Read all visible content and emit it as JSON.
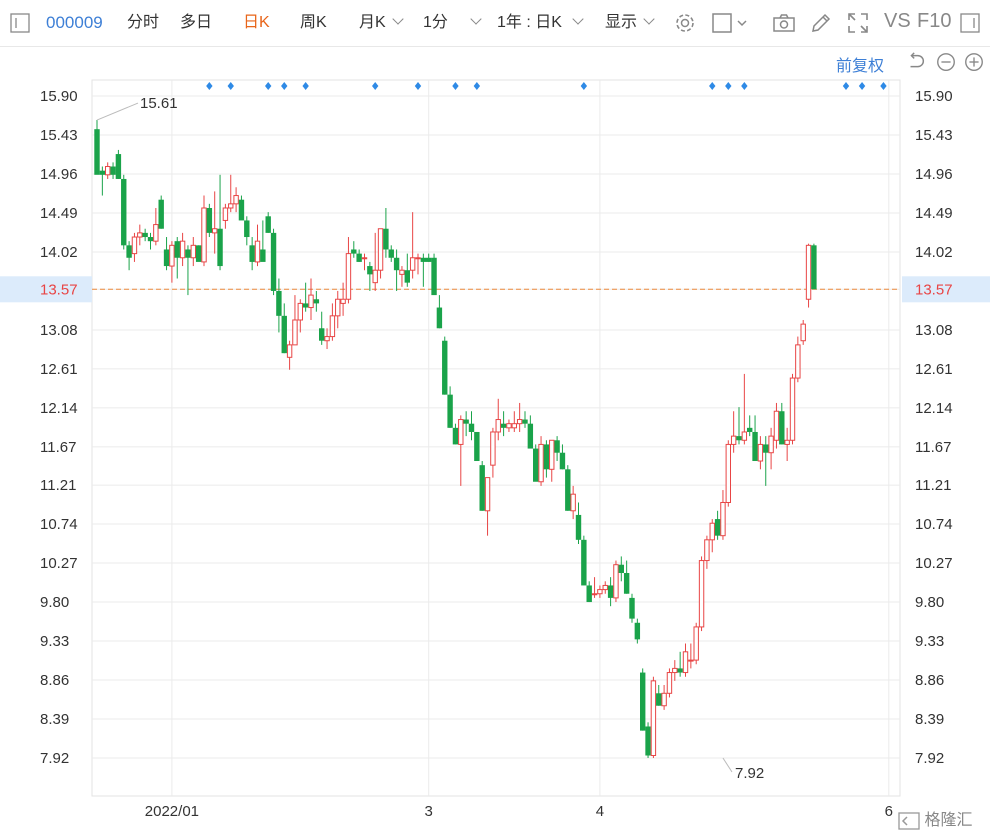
{
  "toolbar": {
    "stock_code": "000009",
    "tabs": [
      "分时",
      "多日",
      "日K",
      "周K",
      "月K",
      "1分"
    ],
    "active_tab": "日K",
    "range_label": "1年 : 日K",
    "display_label": "显示",
    "vs_label": "VS",
    "f10_label": "F10"
  },
  "adjust_label": "前复权",
  "watermark": "格隆汇",
  "colors": {
    "up": "#e84545",
    "down": "#1aa34a",
    "price_line": "#ec8a3c",
    "price_label_bg": "#dcebfb",
    "price_label_text": "#e84545",
    "marker": "#2e8ae6",
    "grid": "#ebebeb",
    "axis_text": "#333333"
  },
  "chart_data": {
    "type": "candlestick",
    "y_ticks": [
      "15.90",
      "15.43",
      "14.96",
      "14.49",
      "14.02",
      "13.57",
      "13.08",
      "12.61",
      "12.14",
      "11.67",
      "11.21",
      "10.74",
      "10.27",
      "9.80",
      "9.33",
      "8.86",
      "8.39",
      "7.92"
    ],
    "ylim": [
      7.92,
      15.9
    ],
    "x_ticks": [
      {
        "label": "2022/01",
        "index": 14
      },
      {
        "label": "3",
        "index": 62
      },
      {
        "label": "4",
        "index": 94
      },
      {
        "label": "6",
        "index": 148
      }
    ],
    "current_price": 13.57,
    "annotations": [
      {
        "text": "15.61",
        "index": 0,
        "price": 15.61
      },
      {
        "text": "7.92",
        "index": 117,
        "price": 7.92
      }
    ],
    "markers": [
      21,
      25,
      32,
      35,
      39,
      52,
      60,
      67,
      71,
      91,
      115,
      118,
      121,
      140,
      143,
      147
    ],
    "candles": [
      [
        15.5,
        15.61,
        15.0,
        14.95
      ],
      [
        15.0,
        15.05,
        14.7,
        14.95
      ],
      [
        14.95,
        15.1,
        14.9,
        15.05
      ],
      [
        15.05,
        15.1,
        14.9,
        14.95
      ],
      [
        15.2,
        15.25,
        14.9,
        14.9
      ],
      [
        14.9,
        14.95,
        14.05,
        14.1
      ],
      [
        14.1,
        14.15,
        13.8,
        13.95
      ],
      [
        14.0,
        14.25,
        13.9,
        14.2
      ],
      [
        14.2,
        14.35,
        14.1,
        14.25
      ],
      [
        14.25,
        14.3,
        14.15,
        14.2
      ],
      [
        14.2,
        14.25,
        14.05,
        14.15
      ],
      [
        14.15,
        14.55,
        14.1,
        14.35
      ],
      [
        14.65,
        14.7,
        14.3,
        14.3
      ],
      [
        14.05,
        14.2,
        13.8,
        13.85
      ],
      [
        13.85,
        14.15,
        13.65,
        14.1
      ],
      [
        14.15,
        14.2,
        13.7,
        13.95
      ],
      [
        13.95,
        14.25,
        13.85,
        14.15
      ],
      [
        14.05,
        14.1,
        13.5,
        13.95
      ],
      [
        13.95,
        14.2,
        13.85,
        14.1
      ],
      [
        14.1,
        14.1,
        13.95,
        13.9
      ],
      [
        13.9,
        14.7,
        13.85,
        14.55
      ],
      [
        14.55,
        14.6,
        14.2,
        14.25
      ],
      [
        14.25,
        14.75,
        14.0,
        14.3
      ],
      [
        14.3,
        14.95,
        13.8,
        13.85
      ],
      [
        14.4,
        14.6,
        14.3,
        14.55
      ],
      [
        14.55,
        14.95,
        14.5,
        14.6
      ],
      [
        14.6,
        14.8,
        14.5,
        14.7
      ],
      [
        14.65,
        14.7,
        14.45,
        14.4
      ],
      [
        14.4,
        14.45,
        14.1,
        14.2
      ],
      [
        14.1,
        14.2,
        13.8,
        13.9
      ],
      [
        13.9,
        14.35,
        13.85,
        14.15
      ],
      [
        14.05,
        14.4,
        13.95,
        13.9
      ],
      [
        14.45,
        14.5,
        14.25,
        14.25
      ],
      [
        14.25,
        14.3,
        13.5,
        13.55
      ],
      [
        13.55,
        13.7,
        13.05,
        13.25
      ],
      [
        13.25,
        13.4,
        12.8,
        12.8
      ],
      [
        12.75,
        12.95,
        12.6,
        12.9
      ],
      [
        12.9,
        13.5,
        12.9,
        13.2
      ],
      [
        13.2,
        13.45,
        13.05,
        13.4
      ],
      [
        13.4,
        13.65,
        13.3,
        13.35
      ],
      [
        13.35,
        13.7,
        13.2,
        13.5
      ],
      [
        13.45,
        13.55,
        13.3,
        13.4
      ],
      [
        13.1,
        13.3,
        12.9,
        12.95
      ],
      [
        12.95,
        13.1,
        12.85,
        13.0
      ],
      [
        13.0,
        13.4,
        12.95,
        13.25
      ],
      [
        13.25,
        13.55,
        13.1,
        13.45
      ],
      [
        13.4,
        13.65,
        13.25,
        13.45
      ],
      [
        13.45,
        14.2,
        13.4,
        14.0
      ],
      [
        14.05,
        14.15,
        13.95,
        14.0
      ],
      [
        14.0,
        14.05,
        13.9,
        13.9
      ],
      [
        13.95,
        14.0,
        13.8,
        13.95
      ],
      [
        13.85,
        13.9,
        13.55,
        13.75
      ],
      [
        13.65,
        14.25,
        13.55,
        13.8
      ],
      [
        13.8,
        14.3,
        13.7,
        14.3
      ],
      [
        14.3,
        14.55,
        13.95,
        14.05
      ],
      [
        14.05,
        14.1,
        13.9,
        13.95
      ],
      [
        13.95,
        14.05,
        13.55,
        13.8
      ],
      [
        13.75,
        13.85,
        13.6,
        13.8
      ],
      [
        13.8,
        14.0,
        13.6,
        13.65
      ],
      [
        13.8,
        14.5,
        13.7,
        13.95
      ],
      [
        13.95,
        14.0,
        13.75,
        13.95
      ],
      [
        13.95,
        14.0,
        13.6,
        13.9
      ],
      [
        13.95,
        14.0,
        13.9,
        13.9
      ],
      [
        13.95,
        14.0,
        13.6,
        13.5
      ],
      [
        13.35,
        13.5,
        13.1,
        13.1
      ],
      [
        12.95,
        13.0,
        12.3,
        12.3
      ],
      [
        12.3,
        12.4,
        11.9,
        11.9
      ],
      [
        11.9,
        11.95,
        11.7,
        11.7
      ],
      [
        11.7,
        12.05,
        11.2,
        12.0
      ],
      [
        12.0,
        12.1,
        11.8,
        11.95
      ],
      [
        11.95,
        12.1,
        11.75,
        11.85
      ],
      [
        11.85,
        11.85,
        11.6,
        11.5
      ],
      [
        11.45,
        11.5,
        10.9,
        10.9
      ],
      [
        10.9,
        11.1,
        10.6,
        11.3
      ],
      [
        11.45,
        11.9,
        11.3,
        11.85
      ],
      [
        11.85,
        12.25,
        11.75,
        12.0
      ],
      [
        11.95,
        12.1,
        11.8,
        11.9
      ],
      [
        11.9,
        12.0,
        11.85,
        11.95
      ],
      [
        11.9,
        12.1,
        11.85,
        11.95
      ],
      [
        11.95,
        12.2,
        11.85,
        12.0
      ],
      [
        12.0,
        12.1,
        11.9,
        11.95
      ],
      [
        11.95,
        12.05,
        11.7,
        11.65
      ],
      [
        11.65,
        11.7,
        11.3,
        11.25
      ],
      [
        11.25,
        11.8,
        11.2,
        11.7
      ],
      [
        11.7,
        11.75,
        11.3,
        11.4
      ],
      [
        11.4,
        11.75,
        11.25,
        11.75
      ],
      [
        11.75,
        11.8,
        11.5,
        11.6
      ],
      [
        11.6,
        11.7,
        11.4,
        11.4
      ],
      [
        11.4,
        11.45,
        10.9,
        10.9
      ],
      [
        10.9,
        11.2,
        10.8,
        11.1
      ],
      [
        10.85,
        11.0,
        10.5,
        10.55
      ],
      [
        10.55,
        10.6,
        10.2,
        10.0
      ],
      [
        10.0,
        10.05,
        9.8,
        9.8
      ],
      [
        9.9,
        10.1,
        9.85,
        9.9
      ],
      [
        9.9,
        10.0,
        9.85,
        9.95
      ],
      [
        9.95,
        10.05,
        9.9,
        10.0
      ],
      [
        10.0,
        10.1,
        9.75,
        9.85
      ],
      [
        9.85,
        10.3,
        9.8,
        10.25
      ],
      [
        10.25,
        10.35,
        10.05,
        10.15
      ],
      [
        10.15,
        10.3,
        9.9,
        9.9
      ],
      [
        9.85,
        9.9,
        9.55,
        9.6
      ],
      [
        9.55,
        9.6,
        9.3,
        9.35
      ],
      [
        8.95,
        9.0,
        8.25,
        8.25
      ],
      [
        8.3,
        8.35,
        7.92,
        7.95
      ],
      [
        7.95,
        8.9,
        7.92,
        8.85
      ],
      [
        8.7,
        8.8,
        8.55,
        8.55
      ],
      [
        8.55,
        8.8,
        8.5,
        8.7
      ],
      [
        8.7,
        9.0,
        8.65,
        8.95
      ],
      [
        8.95,
        9.1,
        8.85,
        9.0
      ],
      [
        9.0,
        9.2,
        8.9,
        8.95
      ],
      [
        8.95,
        9.3,
        8.9,
        9.2
      ],
      [
        9.1,
        9.3,
        9.0,
        9.1
      ],
      [
        9.1,
        9.55,
        9.05,
        9.5
      ],
      [
        9.5,
        10.35,
        9.45,
        10.3
      ],
      [
        10.3,
        10.6,
        10.2,
        10.55
      ],
      [
        10.55,
        10.8,
        10.4,
        10.75
      ],
      [
        10.8,
        10.9,
        10.55,
        10.6
      ],
      [
        10.6,
        11.15,
        10.55,
        11.0
      ],
      [
        11.0,
        11.75,
        10.95,
        11.7
      ],
      [
        11.7,
        12.1,
        11.6,
        11.8
      ],
      [
        11.8,
        12.15,
        11.7,
        11.75
      ],
      [
        11.75,
        12.55,
        11.7,
        11.85
      ],
      [
        11.9,
        12.05,
        11.8,
        11.85
      ],
      [
        11.85,
        12.05,
        11.5,
        11.5
      ],
      [
        11.5,
        11.8,
        11.4,
        11.7
      ],
      [
        11.7,
        11.8,
        11.2,
        11.6
      ],
      [
        11.6,
        11.9,
        11.4,
        11.8
      ],
      [
        11.75,
        12.2,
        11.65,
        12.1
      ],
      [
        12.1,
        12.2,
        11.7,
        11.7
      ],
      [
        11.7,
        11.9,
        11.5,
        11.75
      ],
      [
        11.75,
        12.55,
        11.7,
        12.5
      ],
      [
        12.5,
        13.0,
        12.45,
        12.9
      ],
      [
        12.95,
        13.2,
        12.9,
        13.15
      ],
      [
        13.45,
        14.12,
        13.35,
        14.1
      ],
      [
        14.1,
        14.12,
        13.6,
        13.57
      ]
    ]
  }
}
